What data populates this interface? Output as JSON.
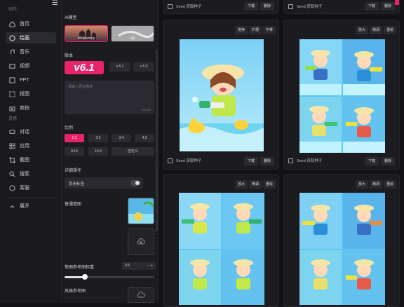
{
  "nav": {
    "section_create": "创作",
    "items": [
      {
        "label": "首页",
        "icon": "home-icon"
      },
      {
        "label": "绘画",
        "icon": "palette-icon",
        "active": true
      },
      {
        "label": "音乐",
        "icon": "music-icon"
      },
      {
        "label": "视频",
        "icon": "video-icon"
      },
      {
        "label": "PPT",
        "icon": "ppt-icon"
      },
      {
        "label": "抠图",
        "icon": "cutout-icon"
      },
      {
        "label": "商拍",
        "icon": "camera-icon"
      }
    ],
    "section_inspire": "灵感",
    "items2": [
      {
        "label": "对话",
        "icon": "chat-icon"
      },
      {
        "label": "应用",
        "icon": "grid-icon"
      },
      {
        "label": "截图",
        "icon": "crop-icon"
      },
      {
        "label": "搜索",
        "icon": "search-icon"
      },
      {
        "label": "客服",
        "icon": "help-icon"
      }
    ],
    "expand_label": "展开"
  },
  "panel": {
    "model_label": "AI模型",
    "models": [
      {
        "name": "Midjourney",
        "selected": true
      },
      {
        "name": "Niji",
        "selected": false
      }
    ],
    "version_label": "版本",
    "version_current": "v6.1",
    "version_options": [
      "v 5.1",
      "v 5.0"
    ],
    "prompt_placeholder": "请输入否定描述",
    "prompt_count": "0/2000",
    "ratio_label": "比例",
    "ratios": [
      "1:1",
      "3:2",
      "3:4",
      "4:3",
      "9:16",
      "16:9"
    ],
    "ratio_custom": "自定义",
    "selected_ratio": "1:1",
    "advanced_label": "详细操作",
    "disable_label": "禁用标签",
    "ref_image_label": "普通垫图",
    "ref_weight_label": "垫图参考图权重",
    "ref_weight_value": "0.5",
    "style_ref_label": "风格参考图"
  },
  "cards": [
    {
      "tools": [
        "变换",
        "扩展",
        "平移"
      ],
      "seed": "Seed  获取种子",
      "download": "下载",
      "delete": "删除"
    },
    {
      "tools": [
        "放大",
        "微调",
        "重绘"
      ],
      "seed": "Seed  获取种子",
      "download": "下载",
      "delete": "删除"
    },
    {
      "tools": [
        "放大",
        "微调",
        "重绘"
      ]
    },
    {
      "tools": [
        "放大",
        "微调",
        "重绘"
      ]
    }
  ],
  "top_strip": {
    "seed": "Seed  获取种子",
    "download": "下载",
    "delete": "删除"
  },
  "colors": {
    "accent": "#e8236a",
    "bg": "#121214",
    "panel": "#1c1c20"
  }
}
